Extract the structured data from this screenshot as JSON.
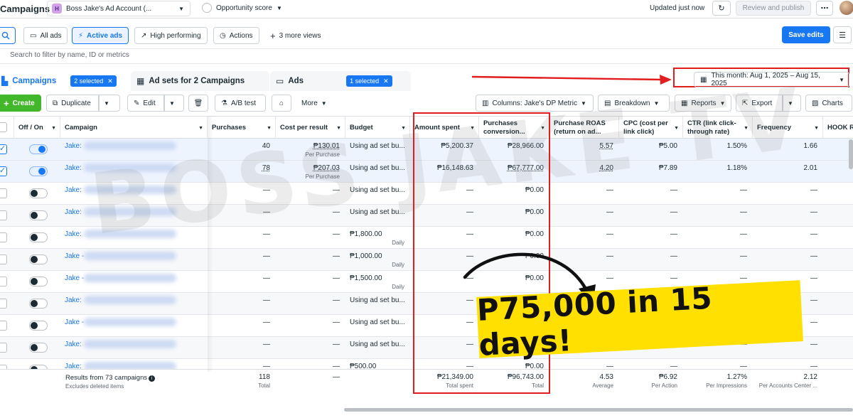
{
  "topbar": {
    "app_title": "Campaigns",
    "account_badge": "H",
    "account_name": "Boss Jake's Ad Account (...",
    "opportunity": "Opportunity score",
    "updated": "Updated just now",
    "review_label": "Review and publish",
    "more_label": "⋯"
  },
  "views": {
    "all_ads": "All ads",
    "active_ads": "Active ads",
    "high_performing": "High performing",
    "actions": "Actions",
    "more_views": "3 more views",
    "save_edits": "Save edits"
  },
  "filter": {
    "placeholder": "Search to filter by name, ID or metrics"
  },
  "tabs": {
    "campaigns": "Campaigns",
    "campaigns_chip": "2 selected",
    "adsets": "Ad sets for 2 Campaigns",
    "ads": "Ads",
    "ads_chip": "1 selected"
  },
  "date_range": "This month: Aug 1, 2025 – Aug 15, 2025",
  "toolbar": {
    "create": "Create",
    "duplicate": "Duplicate",
    "edit": "Edit",
    "ab_test": "A/B test",
    "more": "More",
    "columns": "Columns: Jake's DP Metric",
    "breakdown": "Breakdown",
    "reports": "Reports",
    "export": "Export",
    "charts": "Charts"
  },
  "columns": {
    "off_on": "Off / On",
    "campaign": "Campaign",
    "purchases": "Purchases",
    "cost_per_result": "Cost per result",
    "budget": "Budget",
    "amount_spent": "Amount spent",
    "purchases_conv_1": "Purchases",
    "purchases_conv_2": "conversion...",
    "roas_1": "Purchase ROAS",
    "roas_2": "(return on ad...",
    "cpc_1": "CPC (cost per",
    "cpc_2": "link click)",
    "ctr_1": "CTR (link click-",
    "ctr_2": "through rate)",
    "frequency": "Frequency",
    "hook": "HOOK R"
  },
  "rows": [
    {
      "selected": true,
      "on": true,
      "name": "Jake:",
      "purchases": "40",
      "cpr": "₱130.01",
      "cpr_sub": "Per Purchase",
      "budget": "Using ad set bu...",
      "budget_sub": "",
      "spent": "₱5,200.37",
      "conv": "₱28,966.00",
      "roas": "5.57",
      "cpc": "₱5.00",
      "ctr": "1.50%",
      "freq": "1.66"
    },
    {
      "selected": true,
      "on": true,
      "name": "Jake:",
      "purchases": "78",
      "cpr": "₱207.03",
      "cpr_sub": "Per Purchase",
      "budget": "Using ad set bu...",
      "budget_sub": "",
      "spent": "₱16,148.63",
      "conv": "₱67,777.00",
      "roas": "4.20",
      "cpc": "₱7.89",
      "ctr": "1.18%",
      "freq": "2.01"
    },
    {
      "selected": false,
      "on": false,
      "name": "Jake:",
      "purchases": "—",
      "cpr": "—",
      "cpr_sub": "",
      "budget": "Using ad set bu...",
      "budget_sub": "",
      "spent": "—",
      "conv": "₱0.00",
      "roas": "—",
      "cpc": "—",
      "ctr": "—",
      "freq": "—"
    },
    {
      "selected": false,
      "on": false,
      "name": "Jake:",
      "purchases": "—",
      "cpr": "—",
      "cpr_sub": "",
      "budget": "Using ad set bu...",
      "budget_sub": "",
      "spent": "—",
      "conv": "₱0.00",
      "roas": "—",
      "cpc": "—",
      "ctr": "—",
      "freq": "—"
    },
    {
      "selected": false,
      "on": false,
      "name": "Jake:",
      "purchases": "—",
      "cpr": "—",
      "cpr_sub": "",
      "budget": "₱1,800.00",
      "budget_sub": "Daily",
      "spent": "—",
      "conv": "₱0.00",
      "roas": "—",
      "cpc": "—",
      "ctr": "—",
      "freq": "—"
    },
    {
      "selected": false,
      "on": false,
      "name": "Jake -",
      "purchases": "—",
      "cpr": "—",
      "cpr_sub": "",
      "budget": "₱1,000.00",
      "budget_sub": "Daily",
      "spent": "—",
      "conv": "₱0.00",
      "roas": "—",
      "cpc": "—",
      "ctr": "—",
      "freq": "—"
    },
    {
      "selected": false,
      "on": false,
      "name": "Jake -",
      "purchases": "—",
      "cpr": "—",
      "cpr_sub": "",
      "budget": "₱1,500.00",
      "budget_sub": "Daily",
      "spent": "—",
      "conv": "₱0.00",
      "roas": "—",
      "cpc": "—",
      "ctr": "—",
      "freq": "—"
    },
    {
      "selected": false,
      "on": false,
      "name": "Jake:",
      "purchases": "—",
      "cpr": "—",
      "cpr_sub": "",
      "budget": "Using ad set bu...",
      "budget_sub": "",
      "spent": "—",
      "conv": "₱0.00",
      "roas": "—",
      "cpc": "—",
      "ctr": "—",
      "freq": "—"
    },
    {
      "selected": false,
      "on": false,
      "name": "Jake -",
      "purchases": "—",
      "cpr": "—",
      "cpr_sub": "",
      "budget": "Using ad set bu...",
      "budget_sub": "",
      "spent": "—",
      "conv": "₱0.00",
      "roas": "—",
      "cpc": "—",
      "ctr": "—",
      "freq": "—"
    },
    {
      "selected": false,
      "on": false,
      "name": "Jake:",
      "purchases": "—",
      "cpr": "—",
      "cpr_sub": "",
      "budget": "Using ad set bu...",
      "budget_sub": "",
      "spent": "—",
      "conv": "₱0.00",
      "roas": "—",
      "cpc": "—",
      "ctr": "—",
      "freq": "—"
    },
    {
      "selected": false,
      "on": false,
      "name": "Jake:",
      "purchases": "—",
      "cpr": "—",
      "cpr_sub": "",
      "budget": "₱500.00",
      "budget_sub": "",
      "spent": "—",
      "conv": "₱0.00",
      "roas": "—",
      "cpc": "—",
      "ctr": "—",
      "freq": "—"
    }
  ],
  "summary": {
    "label": "Results from 73 campaigns",
    "sub": "Excludes deleted items",
    "purchases": "118",
    "purchases_sub": "Total",
    "cpr": "—",
    "spent": "₱21,349.00",
    "spent_sub": "Total spent",
    "conv": "₱96,743.00",
    "conv_sub": "Total",
    "roas": "4.53",
    "roas_sub": "Average",
    "cpc": "₱6.92",
    "cpc_sub": "Per Action",
    "ctr": "1.27%",
    "ctr_sub": "Per Impressions",
    "freq": "2.12",
    "freq_sub": "Per Accounts Center ..."
  },
  "overlay": {
    "watermark": "BOSS JAKE TV",
    "promo": "P75,000 in 15 days!"
  },
  "colors": {
    "accent": "#1877f2",
    "create": "#42b72a",
    "highlight": "#e11d1d",
    "promo_bg": "#ffe000"
  }
}
